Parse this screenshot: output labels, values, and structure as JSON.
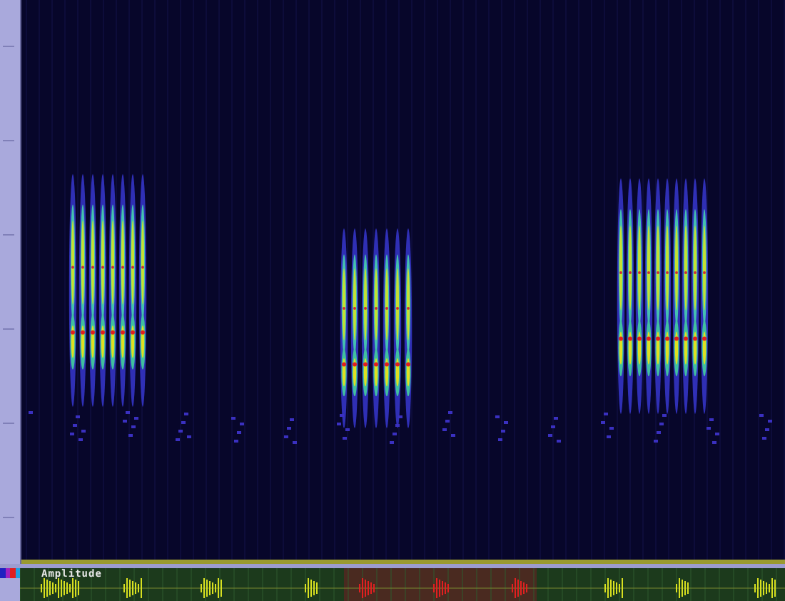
{
  "amplitude_panel": {
    "label": "Amplitude",
    "selection": {
      "visible": true
    }
  }
}
